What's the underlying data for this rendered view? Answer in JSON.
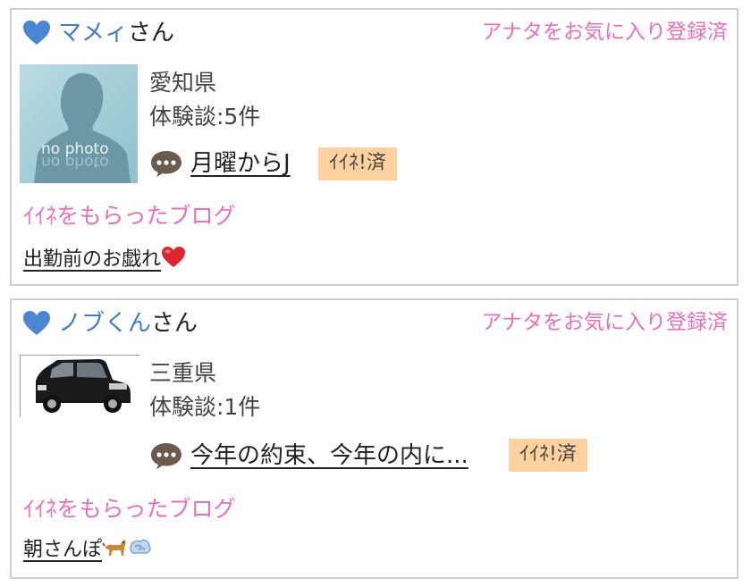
{
  "cards": [
    {
      "name": "マメィ",
      "suffix": "さん",
      "favorite_status": "アナタをお気に入り登録済",
      "photo_text": "no photo",
      "prefecture": "愛知県",
      "experience": "体験談:5件",
      "latest_post": "月曜からJ",
      "iine_badge": "ｲｲﾈ!済",
      "section_title": "ｲｲﾈをもらったブログ",
      "blog_title": "出勤前のお戯れ",
      "blog_emoji": "heart-emoji"
    },
    {
      "name": "ノブくん",
      "suffix": "さん",
      "favorite_status": "アナタをお気に入り登録済",
      "photo_subject": "black-minivan-photo",
      "prefecture": "三重県",
      "experience": "体験談:1件",
      "latest_post": "今年の約束、今年の内に...",
      "iine_badge": "ｲｲﾈ!済",
      "section_title": "ｲｲﾈをもらったブログ",
      "blog_title": "朝さんぽ",
      "blog_emoji": "dog-and-dash-emoji"
    }
  ],
  "colors": {
    "heart": "#4a86d4",
    "name": "#3f7cc9",
    "pink": "#e86fba",
    "badge": "#ffd19e",
    "border": "#cfcfcf"
  }
}
